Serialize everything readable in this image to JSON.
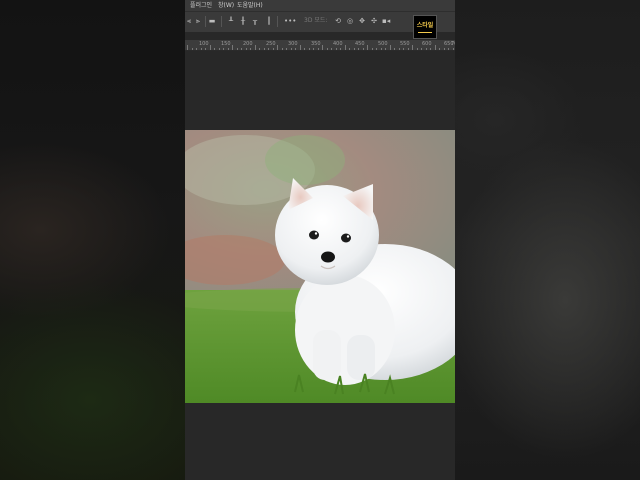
{
  "menubar": {
    "items": [
      {
        "label": "플러그인"
      },
      {
        "label": "창(W)"
      },
      {
        "label": "도움말(H)"
      }
    ]
  },
  "options_bar": {
    "more_label": "•••",
    "mode_3d_label": "3D 모드:"
  },
  "ruler": {
    "labels": [
      "100",
      "150",
      "200",
      "250",
      "300",
      "350",
      "400",
      "450",
      "500",
      "550",
      "600",
      "650",
      "70"
    ]
  },
  "logo": {
    "text": "스타일"
  },
  "colors": {
    "app_bg": "#282828",
    "menubar_bg": "#3a3a3a",
    "logo_accent": "#f2c94c"
  },
  "canvas": {
    "content": "white fluffy puppy on grass"
  }
}
